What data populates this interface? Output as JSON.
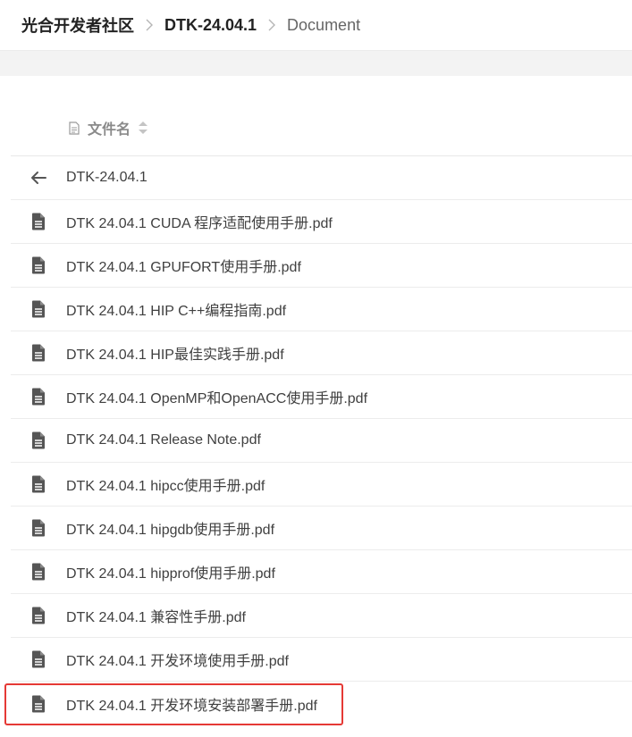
{
  "breadcrumb": {
    "site": "光合开发者社区",
    "folder": "DTK-24.04.1",
    "current": "Document"
  },
  "table": {
    "header_label": "文件名",
    "parent_label": "DTK-24.04.1",
    "files": [
      "DTK 24.04.1 CUDA 程序适配使用手册.pdf",
      "DTK 24.04.1 GPUFORT使用手册.pdf",
      "DTK 24.04.1 HIP C++编程指南.pdf",
      "DTK 24.04.1 HIP最佳实践手册.pdf",
      "DTK 24.04.1 OpenMP和OpenACC使用手册.pdf",
      "DTK 24.04.1 Release Note.pdf",
      "DTK 24.04.1 hipcc使用手册.pdf",
      "DTK 24.04.1 hipgdb使用手册.pdf",
      "DTK 24.04.1 hipprof使用手册.pdf",
      "DTK 24.04.1 兼容性手册.pdf",
      "DTK 24.04.1 开发环境使用手册.pdf",
      "DTK 24.04.1 开发环境安装部署手册.pdf"
    ]
  },
  "highlight": {
    "color": "#e53935",
    "file_index": 11
  },
  "icons": {
    "separator": "chevron-right-icon",
    "back": "arrow-left-icon",
    "file": "file-text-icon",
    "sort": "sort-icon",
    "column": "document-icon"
  }
}
